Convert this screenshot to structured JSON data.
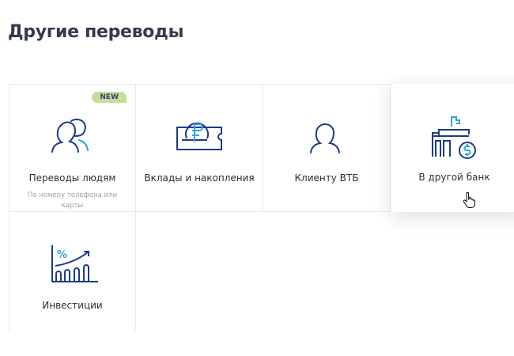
{
  "page": {
    "title": "Другие переводы"
  },
  "tiles": [
    {
      "label": "Переводы людям",
      "subtitle": "По номеру телефона или карты",
      "badge": "NEW",
      "icon": "people-icon"
    },
    {
      "label": "Вклады и накопления",
      "icon": "ruble-deposit-icon"
    },
    {
      "label": "Клиенту ВТБ",
      "icon": "person-icon"
    },
    {
      "label": "В другой банк",
      "icon": "bank-dollar-icon",
      "state": "hovered"
    },
    {
      "label": "Инвестиции",
      "icon": "investment-chart-icon"
    }
  ],
  "colors": {
    "primary": "#1d3a8a",
    "accent": "#2aa5e0",
    "badge": "#c7dc9a"
  }
}
